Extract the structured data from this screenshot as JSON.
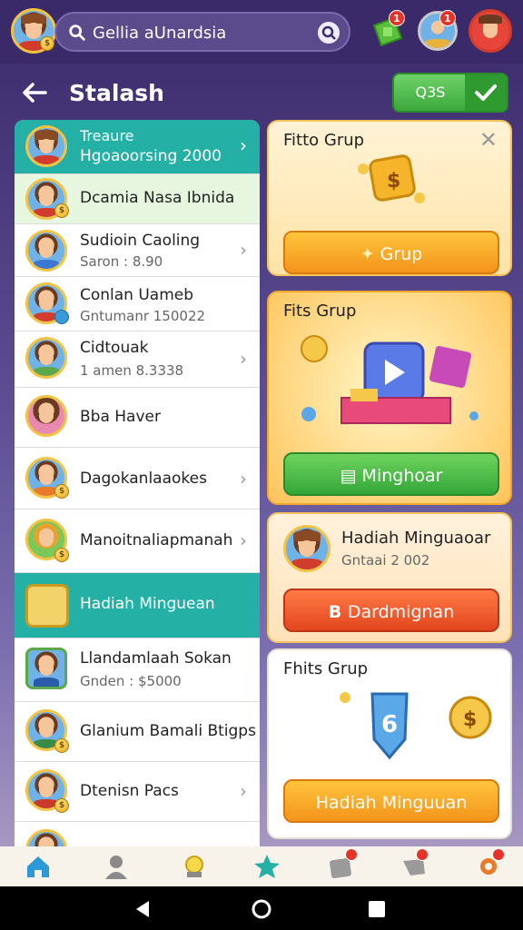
{
  "topbar": {
    "search_text": "Gellia aUnardsia",
    "badges": {
      "gift": "1",
      "profile": "1"
    }
  },
  "header": {
    "title": "Stalash",
    "action_label": "Q3S"
  },
  "list": {
    "rows": [
      {
        "title": "Treaure",
        "subtitle": "Hgoaoorsing 2000"
      },
      {
        "title": "Dcamia Nasa Ibnida",
        "subtitle": ""
      },
      {
        "title": "Sudioin Caoling",
        "subtitle": "Saron : 8.90"
      },
      {
        "title": "Conlan Uameb",
        "subtitle": "Gntumanr 150022"
      },
      {
        "title": "Cidtouak",
        "subtitle": "1 amen 8.3338"
      },
      {
        "title": "Bba Haver",
        "subtitle": ""
      },
      {
        "title": "Dagokanlaaokes",
        "subtitle": ""
      },
      {
        "title": "Manoitnaliapmanah",
        "subtitle": ""
      },
      {
        "title": "Hadiah Minguean",
        "subtitle": ""
      },
      {
        "title": "Llandamlaah Sokan",
        "subtitle": "Gnden : $5000"
      },
      {
        "title": "Glanium Bamali Btigps",
        "subtitle": ""
      },
      {
        "title": "Dtenisn Pacs",
        "subtitle": ""
      }
    ]
  },
  "cards": {
    "card1": {
      "title": "Fitto Grup",
      "button": "Grup"
    },
    "card2": {
      "title": "Fits Grup",
      "button": "Minghoar"
    },
    "card3": {
      "title": "Hadiah Minguaoar",
      "subtitle": "Gntaai 2 002",
      "button": "Dardmignan"
    },
    "card4": {
      "title": "Fhits Grup",
      "button": "Hadiah Minguuan"
    }
  },
  "colors": {
    "teal": "#25b0a6",
    "orange": "#f3941a",
    "green": "#34a73a",
    "red": "#e2461f",
    "topbar": "#3a2a6a"
  }
}
